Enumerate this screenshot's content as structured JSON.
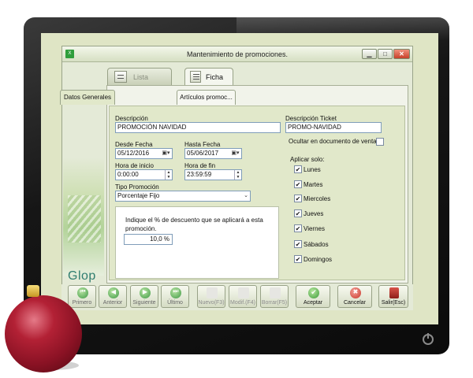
{
  "window": {
    "title": "Mantenimiento de promociones.",
    "controls": {
      "minimize": "▁",
      "maximize": "□",
      "close": "✕"
    }
  },
  "tabs": {
    "lista": "Lista",
    "ficha": "Ficha"
  },
  "subtabs": {
    "general": "Datos Generales",
    "articulos": "Artículos promoc..."
  },
  "form": {
    "descripcion_label": "Descripción",
    "descripcion_value": "PROMOCIÓN NAVIDAD",
    "desc_ticket_label": "Descripción Ticket",
    "desc_ticket_value": "PROMO-NAVIDAD",
    "ocultar_label": "Ocultar en documento de venta",
    "ocultar_checked": "",
    "desde_label": "Desde Fecha",
    "desde_value": "05/12/2016",
    "hasta_label": "Hasta Fecha",
    "hasta_value": "05/06/2017",
    "hora_inicio_label": "Hora de inicio",
    "hora_inicio_value": "0:00:00",
    "hora_fin_label": "Hora de fin",
    "hora_fin_value": "23:59:59",
    "tipo_label": "Tipo Promoción",
    "tipo_value": "Porcentaje Fijo",
    "aplicar_label": "Aplicar solo:",
    "days": [
      {
        "label": "Lunes",
        "check": "✔"
      },
      {
        "label": "Martes",
        "check": "✔"
      },
      {
        "label": "Miercoles",
        "check": "✔"
      },
      {
        "label": "Jueves",
        "check": "✔"
      },
      {
        "label": "Viernes",
        "check": "✔"
      },
      {
        "label": "Sábados",
        "check": "✔"
      },
      {
        "label": "Domingos",
        "check": "✔"
      }
    ],
    "discount_text": "Indique el % de descuento que se aplicará a esta promoción.",
    "discount_value": "10,0 %"
  },
  "brand": "Glop",
  "toolbar": [
    {
      "label": "Primero",
      "glyph": "⏮"
    },
    {
      "label": "Anterior",
      "glyph": "◀"
    },
    {
      "label": "Siguiente",
      "glyph": "▶"
    },
    {
      "label": "Último",
      "glyph": "⏭"
    },
    {
      "label": "Nuevo(F3)",
      "glyph": ""
    },
    {
      "label": "Modif.(F4)",
      "glyph": ""
    },
    {
      "label": "Borrar(F5)",
      "glyph": ""
    },
    {
      "label": "Aceptar",
      "glyph": "✔"
    },
    {
      "label": "Cancelar",
      "glyph": "✖"
    },
    {
      "label": "Salir(Esc)",
      "glyph": ""
    }
  ],
  "colors": {
    "accent_green": "#3f9a45",
    "cancel_red": "#c93428",
    "panel_green": "#e1e8ca"
  }
}
